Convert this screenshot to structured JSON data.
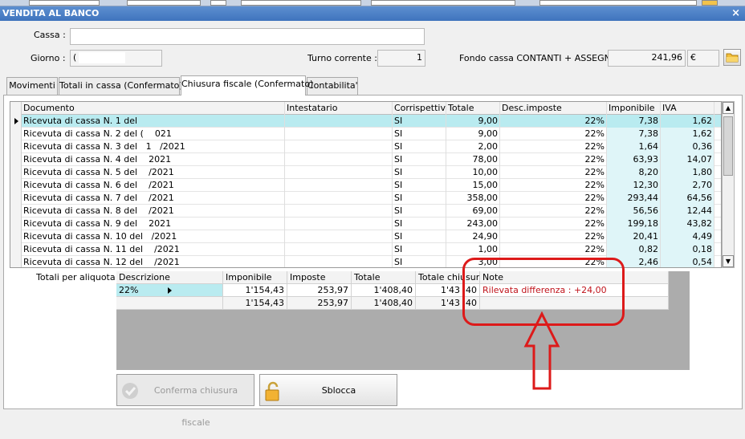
{
  "window": {
    "title": "VENDITA AL BANCO",
    "close_glyph": "×"
  },
  "header": {
    "cassa_label": "Cassa :",
    "cassa_value": "",
    "giorno_label": "Giorno :",
    "giorno_value": "(",
    "turno_label": "Turno corrente :",
    "turno_value": "1",
    "fondo_label": "Fondo cassa CONTANTI + ASSEGNI :",
    "fondo_value": "241,96",
    "currency": "€"
  },
  "tabs": [
    {
      "label": "Movimenti"
    },
    {
      "label": "Totali in cassa (Confermato)"
    },
    {
      "label": "Chiusura fiscale (Confermato)",
      "active": true
    },
    {
      "label": "Contabilita'"
    }
  ],
  "grid": {
    "columns": [
      "Documento",
      "Intestatario",
      "Corrispettivi",
      "Totale",
      "Desc.imposte",
      "Imponibile",
      "IVA"
    ],
    "rows": [
      {
        "doc": "Ricevuta di cassa N. 1 del",
        "date": "",
        "corr": "SI",
        "tot": "9,00",
        "desc": "22%",
        "imp": "7,38",
        "iva": "1,62"
      },
      {
        "doc": "Ricevuta di cassa N. 2 del",
        "date": "(    021",
        "corr": "SI",
        "tot": "9,00",
        "desc": "22%",
        "imp": "7,38",
        "iva": "1,62"
      },
      {
        "doc": "Ricevuta di cassa N. 3 del",
        "date": "  1   /2021",
        "corr": "SI",
        "tot": "2,00",
        "desc": "22%",
        "imp": "1,64",
        "iva": "0,36"
      },
      {
        "doc": "Ricevuta di cassa N. 4 del",
        "date": "   2021",
        "corr": "SI",
        "tot": "78,00",
        "desc": "22%",
        "imp": "63,93",
        "iva": "14,07"
      },
      {
        "doc": "Ricevuta di cassa N. 5 del",
        "date": "   /2021",
        "corr": "SI",
        "tot": "10,00",
        "desc": "22%",
        "imp": "8,20",
        "iva": "1,80"
      },
      {
        "doc": "Ricevuta di cassa N. 6 del",
        "date": "   /2021",
        "corr": "SI",
        "tot": "15,00",
        "desc": "22%",
        "imp": "12,30",
        "iva": "2,70"
      },
      {
        "doc": "Ricevuta di cassa N. 7 del",
        "date": "   /2021",
        "corr": "SI",
        "tot": "358,00",
        "desc": "22%",
        "imp": "293,44",
        "iva": "64,56"
      },
      {
        "doc": "Ricevuta di cassa N. 8 del",
        "date": "   /2021",
        "corr": "SI",
        "tot": "69,00",
        "desc": "22%",
        "imp": "56,56",
        "iva": "12,44"
      },
      {
        "doc": "Ricevuta di cassa N. 9 del",
        "date": "   2021",
        "corr": "SI",
        "tot": "243,00",
        "desc": "22%",
        "imp": "199,18",
        "iva": "43,82"
      },
      {
        "doc": "Ricevuta di cassa N. 10 del",
        "date": "  /2021",
        "corr": "SI",
        "tot": "24,90",
        "desc": "22%",
        "imp": "20,41",
        "iva": "4,49"
      },
      {
        "doc": "Ricevuta di cassa N. 11 del",
        "date": "   /2021",
        "corr": "SI",
        "tot": "1,00",
        "desc": "22%",
        "imp": "0,82",
        "iva": "0,18"
      },
      {
        "doc": "Ricevuta di cassa N. 12 del",
        "date": "   /2021",
        "corr": "SI",
        "tot": "3,00",
        "desc": "22%",
        "imp": "2,46",
        "iva": "0,54"
      }
    ]
  },
  "totals": {
    "label": "Totali per aliquota :",
    "columns": [
      "Descrizione",
      "Imponibile",
      "Imposte",
      "Totale",
      "Totale chiusura",
      "Note"
    ],
    "rows": [
      {
        "desc": "22%",
        "imp": "1'154,43",
        "impo": "253,97",
        "tot": "1'408,40",
        "totc": "1'43  ,40",
        "note": "Rilevata differenza : +24,00"
      }
    ],
    "summary": {
      "imp": "1'154,43",
      "impo": "253,97",
      "tot": "1'408,40",
      "totc": "1'43  ,40"
    }
  },
  "buttons": {
    "conferma": "Conferma chiusura fiscale",
    "sblocca": "Sblocca"
  },
  "colors": {
    "titlebar": "#4a7fc4",
    "selection": "#b9ebf0",
    "annotation": "#dd1a1a",
    "note_text": "#c0141c"
  }
}
